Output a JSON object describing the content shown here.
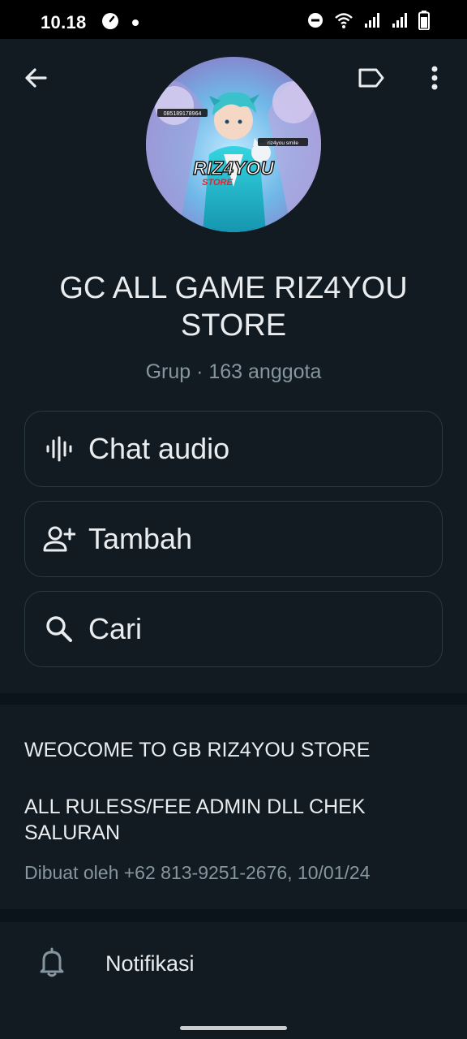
{
  "status_bar": {
    "time": "10.18",
    "icons": [
      "speed-icon",
      "dot-icon",
      "dnd-icon",
      "wifi-icon",
      "signal-icon",
      "signal-icon",
      "battery-icon"
    ]
  },
  "topbar": {
    "icons": [
      "back-arrow-icon",
      "label-tag-icon",
      "more-vert-icon"
    ]
  },
  "avatar": {
    "title_text": "RIZ4YOU",
    "subtitle_text": "STORE",
    "phone_badge": "085189178964",
    "account_badge": "riz4you smile"
  },
  "group": {
    "name": "GC ALL GAME RIZ4YOU STORE",
    "meta": "Grup · 163 anggota"
  },
  "actions": [
    {
      "label": "Chat audio",
      "icon": "audio-wave-icon"
    },
    {
      "label": "Tambah",
      "icon": "add-person-icon"
    },
    {
      "label": "Cari",
      "icon": "search-icon"
    }
  ],
  "description": {
    "line1": "WEOCOME TO GB RIZ4YOU STORE",
    "line2": "ALL RULESS/FEE ADMIN DLL CHEK SALURAN",
    "created": "Dibuat oleh +62 813-9251-2676, 10/01/24"
  },
  "notifications": {
    "label": "Notifikasi",
    "icon": "bell-icon"
  },
  "colors": {
    "background": "#0b141a",
    "card": "#121b22",
    "primary_text": "#e9edef",
    "secondary_text": "#8696a0",
    "border": "#2a3942"
  }
}
